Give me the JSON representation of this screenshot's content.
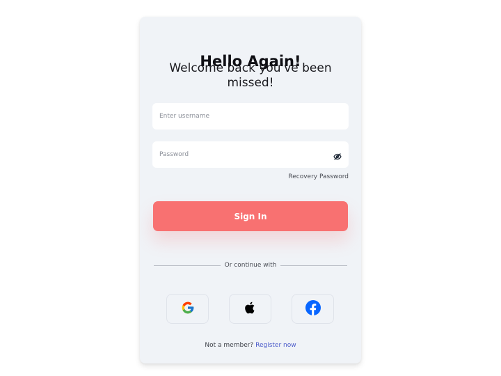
{
  "card": {
    "title": "Hello Again!",
    "subtitle": "Welcome back you've been missed!"
  },
  "form": {
    "username": {
      "placeholder": "Enter username",
      "value": ""
    },
    "password": {
      "placeholder": "Password",
      "value": "",
      "toggle_icon": "eye-off-icon"
    },
    "recovery_label": "Recovery Password",
    "signin_label": "Sign In"
  },
  "social": {
    "divider_label": "Or continue with",
    "buttons": [
      {
        "name": "google",
        "icon": "google-icon"
      },
      {
        "name": "apple",
        "icon": "apple-icon"
      },
      {
        "name": "facebook",
        "icon": "facebook-icon"
      }
    ]
  },
  "footer": {
    "prompt": "Not a member?",
    "register_label": "Register now"
  },
  "colors": {
    "page_background": "#ffffff",
    "card_background": "#f0f3f7",
    "primary_button": "#f87171",
    "link": "#4858c9",
    "facebook": "#0866ff"
  }
}
